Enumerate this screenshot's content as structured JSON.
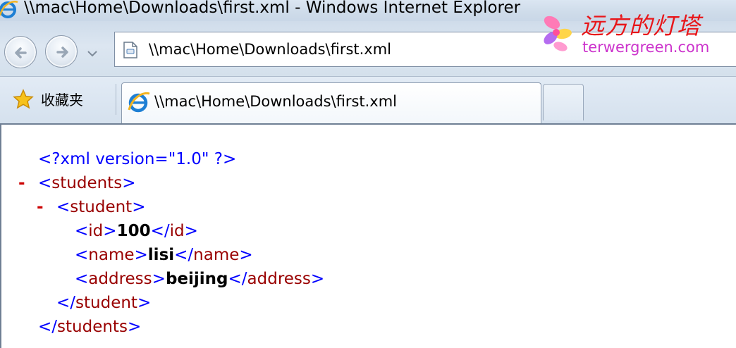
{
  "window": {
    "title": "\\\\mac\\Home\\Downloads\\first.xml - Windows Internet Explorer"
  },
  "address_bar": {
    "url": "\\\\mac\\Home\\Downloads\\first.xml"
  },
  "watermark": {
    "cn_text": "远方的灯塔",
    "site": "terwergreen.com"
  },
  "favorites": {
    "label": "收藏夹"
  },
  "tab": {
    "label": "\\\\mac\\Home\\Downloads\\first.xml"
  },
  "xml": {
    "decl": "<?xml version=\"1.0\" ?>",
    "minus": "-",
    "lt": "<",
    "gt": ">",
    "lt_close": "</",
    "root_tag": "students",
    "item_tag": "student",
    "fields": [
      {
        "tag": "id",
        "value": "100"
      },
      {
        "tag": "name",
        "value": "lisi"
      },
      {
        "tag": "address",
        "value": "beijing"
      }
    ]
  },
  "colors": {
    "markup_blue": "#0000ff",
    "tag_name_red": "#990000",
    "collapse_minus": "#cc0000",
    "watermark_red": "#e8161a",
    "watermark_magenta": "#cc33cc"
  },
  "icons": [
    "ie-icon",
    "back-icon",
    "forward-icon",
    "dropdown-icon",
    "page-icon",
    "favorites-star-icon",
    "flower-logo-icon"
  ]
}
